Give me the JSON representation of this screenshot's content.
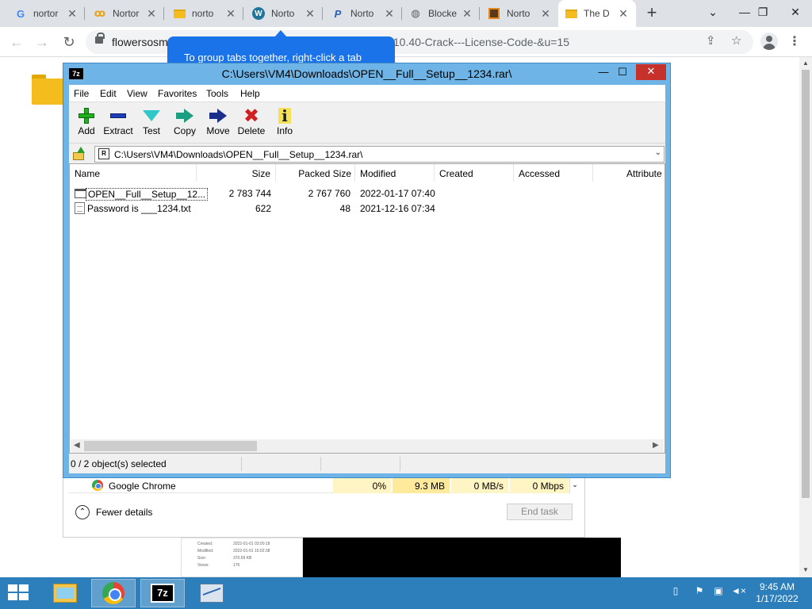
{
  "browser": {
    "tabs": [
      {
        "label": "nortor",
        "icon": "G"
      },
      {
        "label": "Nortor",
        "icon": "ꝏ"
      },
      {
        "label": "norto",
        "icon": "folder"
      },
      {
        "label": "Norto",
        "icon": "W"
      },
      {
        "label": "Norto",
        "icon": "P"
      },
      {
        "label": "Blocke",
        "icon": "globe"
      },
      {
        "label": "Norto",
        "icon": "fox"
      },
      {
        "label": "The D",
        "icon": "folder"
      }
    ],
    "new_tab": "+",
    "url_left": "flowersosm",
    "url_right": ".10.40-Crack---License-Code-&u=15",
    "tooltip": "To group tabs together, right-click a tab"
  },
  "sevenzip": {
    "title": "C:\\Users\\VM4\\Downloads\\OPEN__Full__Setup__1234.rar\\",
    "app_icon": "7z",
    "menu": [
      "File",
      "Edit",
      "View",
      "Favorites",
      "Tools",
      "Help"
    ],
    "toolbar": [
      "Add",
      "Extract",
      "Test",
      "Copy",
      "Move",
      "Delete",
      "Info"
    ],
    "address": "C:\\Users\\VM4\\Downloads\\OPEN__Full__Setup__1234.rar\\",
    "columns": [
      "Name",
      "Size",
      "Packed Size",
      "Modified",
      "Created",
      "Accessed",
      "Attribute"
    ],
    "files": [
      {
        "name": "OPEN__Full__Setup__12...",
        "size": "2 783 744",
        "packed": "2 767 760",
        "modified": "2022-01-17 07:40",
        "type": "exe"
      },
      {
        "name": "Password is ___1234.txt",
        "size": "622",
        "packed": "48",
        "modified": "2021-12-16 07:34",
        "type": "txt"
      }
    ],
    "status": "0 / 2 object(s) selected"
  },
  "taskmanager": {
    "process": "Google Chrome",
    "cpu": "0%",
    "memory": "9.3 MB",
    "disk": "0 MB/s",
    "network": "0 Mbps",
    "fewer_details": "Fewer details",
    "end_task": "End task"
  },
  "props_thumb": {
    "rows": [
      {
        "k": "Created:",
        "v": "2022-01-01 03:00:18"
      },
      {
        "k": "Modified:",
        "v": "2022-01-01 15:02:38"
      },
      {
        "k": "Size:",
        "v": "370.69 KB"
      },
      {
        "k": "Views:",
        "v": "176"
      }
    ]
  },
  "taskbar": {
    "time": "9:45 AM",
    "date": "1/17/2022",
    "app_7z": "7z"
  },
  "colors": {
    "taskbar": "#2c7fbb",
    "zip_frame": "#6fb4e6",
    "tooltip": "#1a73e8",
    "close_red": "#c7312b"
  }
}
